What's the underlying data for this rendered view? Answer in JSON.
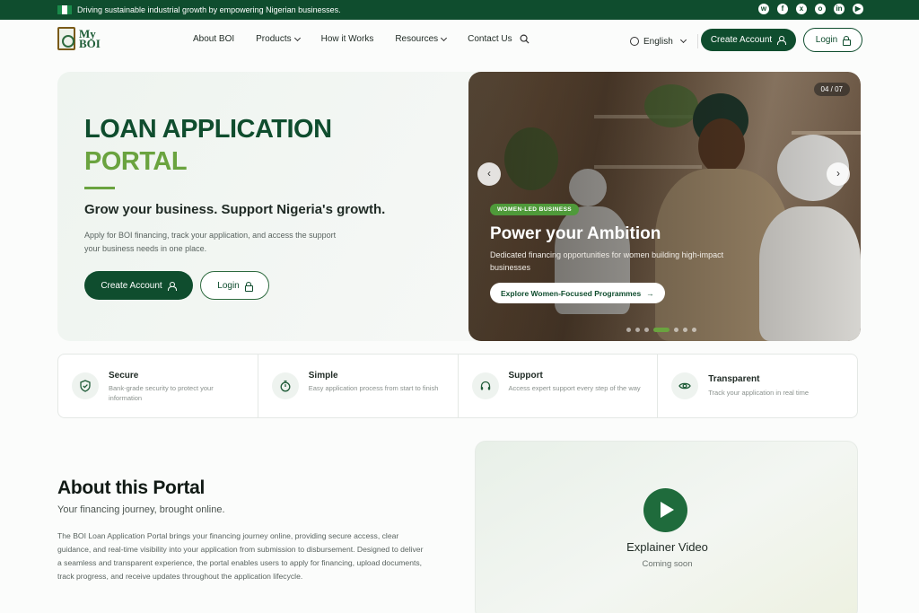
{
  "topbar": {
    "tagline": "Driving sustainable industrial growth by empowering Nigerian businesses.",
    "socials": [
      "whatsapp-icon",
      "facebook-icon",
      "x-icon",
      "instagram-icon",
      "linkedin-icon",
      "youtube-icon"
    ]
  },
  "nav": {
    "logo_line1": "My",
    "logo_line2": "BOI",
    "links": [
      {
        "label": "About BOI",
        "dropdown": false
      },
      {
        "label": "Products",
        "dropdown": true
      },
      {
        "label": "How it Works",
        "dropdown": false
      },
      {
        "label": "Resources",
        "dropdown": true
      },
      {
        "label": "Contact Us",
        "dropdown": false
      }
    ],
    "language": "English",
    "create_account": "Create Account",
    "login": "Login"
  },
  "hero": {
    "title_line1": "LOAN APPLICATION",
    "title_line2": "PORTAL",
    "subtitle": "Grow your business. Support Nigeria's growth.",
    "description": "Apply for BOI financing, track your application, and access the support your business needs in one place.",
    "create_account": "Create Account",
    "login": "Login"
  },
  "slide": {
    "counter": "04 / 07",
    "badge": "WOMEN-LED BUSINESS",
    "title": "Power your Ambition",
    "description": "Dedicated financing opportunities for women building high-impact businesses",
    "cta": "Explore Women-Focused Programmes",
    "active_slide": 4,
    "dots": 7
  },
  "features": [
    {
      "title": "Secure",
      "desc": "Bank-grade security to protect your information",
      "icon": "shield-icon"
    },
    {
      "title": "Simple",
      "desc": "Easy application process from start to finish",
      "icon": "timer-icon"
    },
    {
      "title": "Support",
      "desc": "Access expert support every step of the way",
      "icon": "headset-icon"
    },
    {
      "title": "Transparent",
      "desc": "Track your application in real time",
      "icon": "eye-icon"
    }
  ],
  "about": {
    "title": "About this Portal",
    "subtitle": "Your financing journey, brought online.",
    "body": "The BOI Loan Application Portal brings your financing journey online, providing secure access, clear guidance, and real-time visibility into your application from submission to disbursement. Designed to deliver a seamless and transparent experience, the portal enables users to apply for financing, upload documents, track progress, and receive updates throughout the application lifecycle."
  },
  "video": {
    "title": "Explainer Video",
    "subtitle": "Coming soon"
  },
  "colors": {
    "brand_dark": "#0f4d2e",
    "brand_accent": "#6aa33f"
  }
}
